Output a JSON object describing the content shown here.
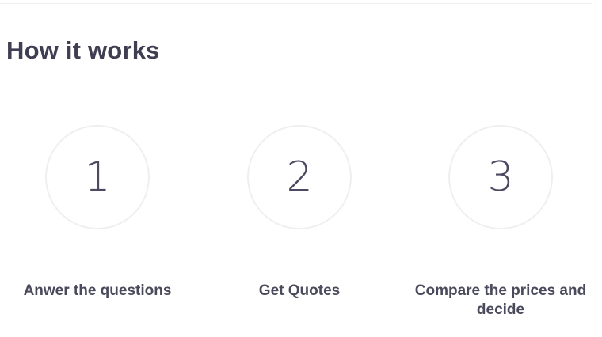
{
  "section": {
    "title": "How it works"
  },
  "steps": [
    {
      "number": "1",
      "label": "Anwer the questions"
    },
    {
      "number": "2",
      "label": "Get Quotes"
    },
    {
      "number": "3",
      "label": "Compare the prices and decide"
    }
  ],
  "colors": {
    "text": "#3f3e52",
    "circle_border": "#efeff1",
    "background": "#ffffff"
  }
}
